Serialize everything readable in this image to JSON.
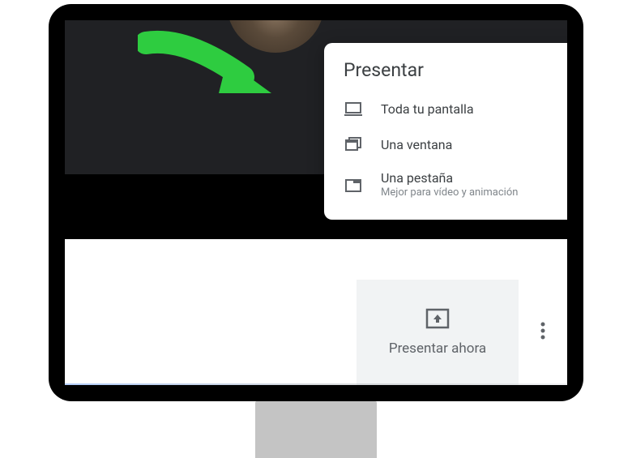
{
  "popup": {
    "title": "Presentar",
    "items": [
      {
        "label": "Toda tu pantalla",
        "sub": ""
      },
      {
        "label": "Una ventana",
        "sub": ""
      },
      {
        "label": "Una pestaña",
        "sub": "Mejor para vídeo y animación"
      }
    ]
  },
  "bottomBar": {
    "presentLabel": "Presentar ahora"
  }
}
